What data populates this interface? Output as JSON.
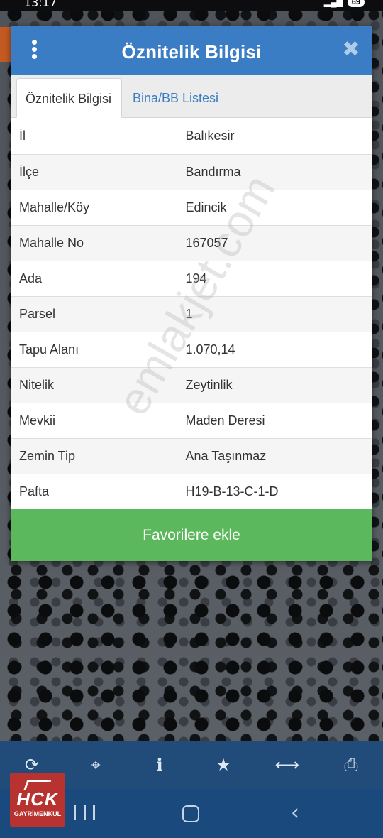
{
  "status_bar": {
    "time": "13:17",
    "battery": "69",
    "signal_icons": "wifi-signal-icons"
  },
  "dialog": {
    "title": "Öznitelik Bilgisi",
    "menu_icon": "more-vertical-icon",
    "close_icon": "close-icon",
    "close_glyph": "✖",
    "tabs": [
      {
        "label": "Öznitelik Bilgisi",
        "active": true
      },
      {
        "label": "Bina/BB Listesi",
        "active": false
      }
    ],
    "rows": [
      {
        "key": "İl",
        "value": "Balıkesir"
      },
      {
        "key": "İlçe",
        "value": "Bandırma"
      },
      {
        "key": "Mahalle/Köy",
        "value": "Edincik"
      },
      {
        "key": "Mahalle No",
        "value": "167057"
      },
      {
        "key": "Ada",
        "value": "194"
      },
      {
        "key": "Parsel",
        "value": "1"
      },
      {
        "key": "Tapu Alanı",
        "value": "1.070,14"
      },
      {
        "key": "Nitelik",
        "value": "Zeytinlik"
      },
      {
        "key": "Mevkii",
        "value": "Maden Deresi"
      },
      {
        "key": "Zemin Tip",
        "value": "Ana Taşınmaz"
      },
      {
        "key": "Pafta",
        "value": "H19-B-13-C-1-D"
      }
    ],
    "favorite_button": "Favorilere ekle"
  },
  "watermark": "emlakjet.com",
  "toolbar": {
    "tools": [
      {
        "name": "refresh-icon",
        "glyph": "⟳"
      },
      {
        "name": "locate-icon",
        "glyph": "⌖"
      },
      {
        "name": "info-icon",
        "glyph": "ℹ"
      },
      {
        "name": "star-icon",
        "glyph": "★"
      },
      {
        "name": "measure-icon",
        "glyph": "⟷"
      },
      {
        "name": "print-icon",
        "glyph": "⎙"
      }
    ]
  },
  "logo": {
    "mark": "HCK",
    "sub": "GAYRİMENKUL"
  },
  "colors": {
    "header": "#3b7dc4",
    "button": "#5cb85c",
    "toolbar": "#214b79"
  }
}
